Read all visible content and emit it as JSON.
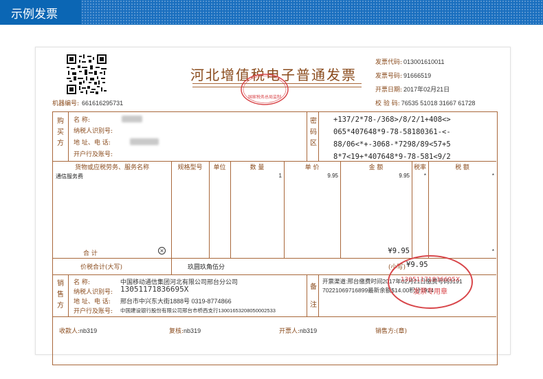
{
  "header": {
    "title": "示例发票"
  },
  "invoice": {
    "title": "河北增值税电子普通发票",
    "machine_no_label": "机器编号:",
    "machine_no": "661616295731",
    "invoice_code_label": "发票代码:",
    "invoice_code": "013001610011",
    "invoice_number_label": "发票号码:",
    "invoice_number": "91666519",
    "issue_date_label": "开票日期:",
    "issue_date": "2017年02月21日",
    "check_code_label": "校 验 码:",
    "check_code": "76535 51018 31667 61728",
    "tax_seal_text": "国家税务总局监制",
    "buyer": {
      "section_label": "购买方",
      "name_label": "名        称:",
      "taxpayer_id_label": "纳税人识别号:",
      "address_phone_label": "地 址、电 话:",
      "bank_account_label": "开户行及账号:"
    },
    "cipher": {
      "section_label": "密码区",
      "lines": [
        "+137/2*78-/368>/8/2/1+408<>",
        "065*407648*9-78-58180361-<-",
        "88/06<*+-3068-*7298/89<57+5",
        "8*7<19+*407648*9-78-581<9/2"
      ]
    },
    "items": {
      "headers": {
        "name": "货物或应税劳务、服务名称",
        "spec": "规格型号",
        "unit": "单位",
        "qty": "数 量",
        "price": "单 价",
        "amount": "金 额",
        "rate": "税率",
        "tax": "税 额"
      },
      "rows": [
        {
          "name": "通信服务费",
          "qty": "1",
          "price": "9.95",
          "amount": "9.95",
          "rate": "*",
          "tax": "*"
        }
      ],
      "total_label": "合          计",
      "total_amount": "¥9.95",
      "total_tax": "*"
    },
    "sum": {
      "label": "价税合计(大写)",
      "in_words": "玖圆玖角伍分",
      "small_label": "(小写)",
      "small_value": "¥9.95"
    },
    "seller": {
      "section_label": "销售方",
      "name_label": "名        称:",
      "name": "中国移动通信集团河北有限公司邢台分公司",
      "taxpayer_id_label": "纳税人识别号:",
      "taxpayer_id": "13051171836695X",
      "address_phone_label": "地 址、电 话:",
      "address_phone": "邢台市中兴东大街1888号 0319-8774866",
      "bank_account_label": "开户行及账号:",
      "bank_account": "中国建设银行股份有限公司邢台市桥西支行13001653208050002533"
    },
    "remarks": {
      "section_label": "备注",
      "line1": "开票渠道:邢台缴费时间2017年02月21日缴费号码3191",
      "line2": "70221069716899最新余额$14.00积分1924"
    },
    "invoice_seal": {
      "number": "13051171836695X",
      "text": "发票专用章"
    },
    "footer": {
      "payee_label": "收款人:",
      "payee": "nb319",
      "reviewer_label": "复核:",
      "reviewer": "nb319",
      "drawer_label": "开票人:",
      "drawer": "nb319",
      "seller_label": "销售方:(章)"
    }
  }
}
